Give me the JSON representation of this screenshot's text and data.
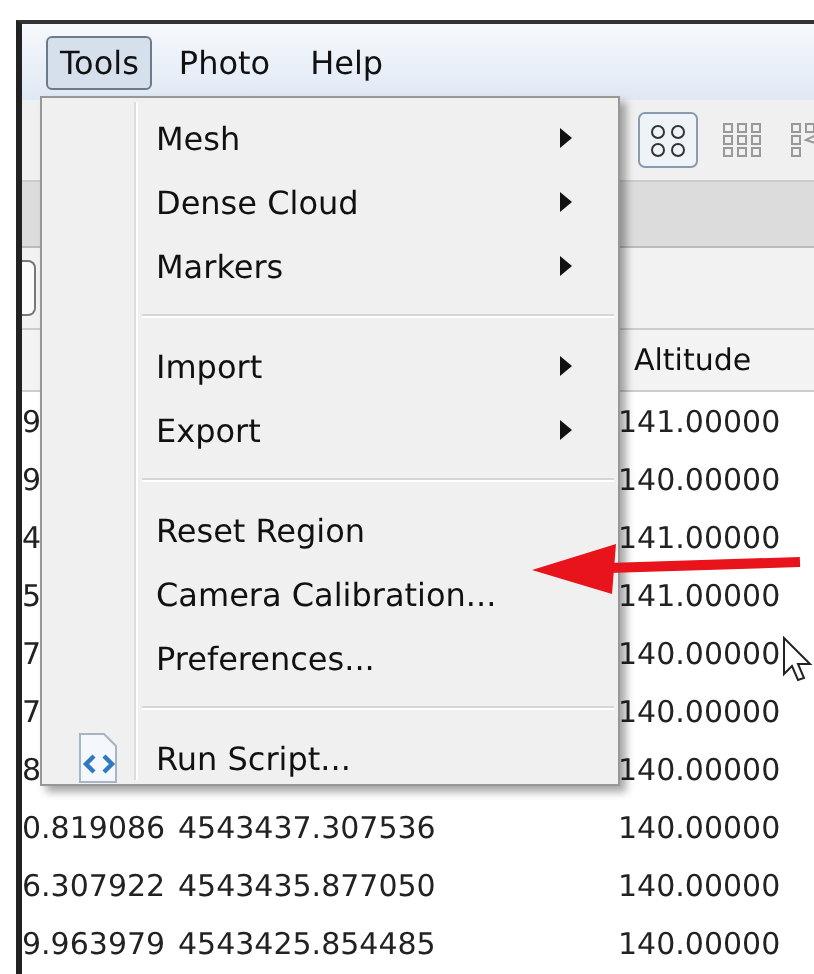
{
  "menu_bar": [
    {
      "label": "Tools",
      "selected": true
    },
    {
      "label": "Photo",
      "selected": false
    },
    {
      "label": "Help",
      "selected": false
    }
  ],
  "tools_menu": {
    "items": [
      {
        "label": "Mesh",
        "submenu": true,
        "separator_after": false,
        "icon": false
      },
      {
        "label": "Dense Cloud",
        "submenu": true,
        "separator_after": false,
        "icon": false
      },
      {
        "label": "Markers",
        "submenu": true,
        "separator_after": true,
        "icon": false
      },
      {
        "label": "Import",
        "submenu": true,
        "separator_after": false,
        "icon": false
      },
      {
        "label": "Export",
        "submenu": true,
        "separator_after": true,
        "icon": false
      },
      {
        "label": "Reset Region",
        "submenu": false,
        "separator_after": false,
        "icon": false
      },
      {
        "label": "Camera Calibration...",
        "submenu": false,
        "separator_after": false,
        "icon": false
      },
      {
        "label": "Preferences...",
        "submenu": false,
        "separator_after": true,
        "icon": false
      },
      {
        "label": "Run Script...",
        "submenu": false,
        "separator_after": false,
        "icon": true
      }
    ]
  },
  "table": {
    "columns": [
      "Altitude"
    ],
    "rows": [
      {
        "column_1": "9",
        "column_2": "",
        "altitude": "141.00000"
      },
      {
        "column_1": "9",
        "column_2": "",
        "altitude": "140.00000"
      },
      {
        "column_1": "4",
        "column_2": "",
        "altitude": "141.00000"
      },
      {
        "column_1": "5",
        "column_2": "",
        "altitude": "141.00000"
      },
      {
        "column_1": "7",
        "column_2": "",
        "altitude": "140.00000"
      },
      {
        "column_1": "7",
        "column_2": "",
        "altitude": "140.00000"
      },
      {
        "column_1": "8",
        "column_2": "",
        "altitude": "140.00000"
      },
      {
        "column_1": "0.819086",
        "column_2": "4543437.307536",
        "altitude": "140.00000"
      },
      {
        "column_1": "6.307922",
        "column_2": "4543435.877050",
        "altitude": "140.00000"
      },
      {
        "column_1": "9.963979",
        "column_2": "4543425.854485",
        "altitude": "140.00000"
      }
    ]
  }
}
